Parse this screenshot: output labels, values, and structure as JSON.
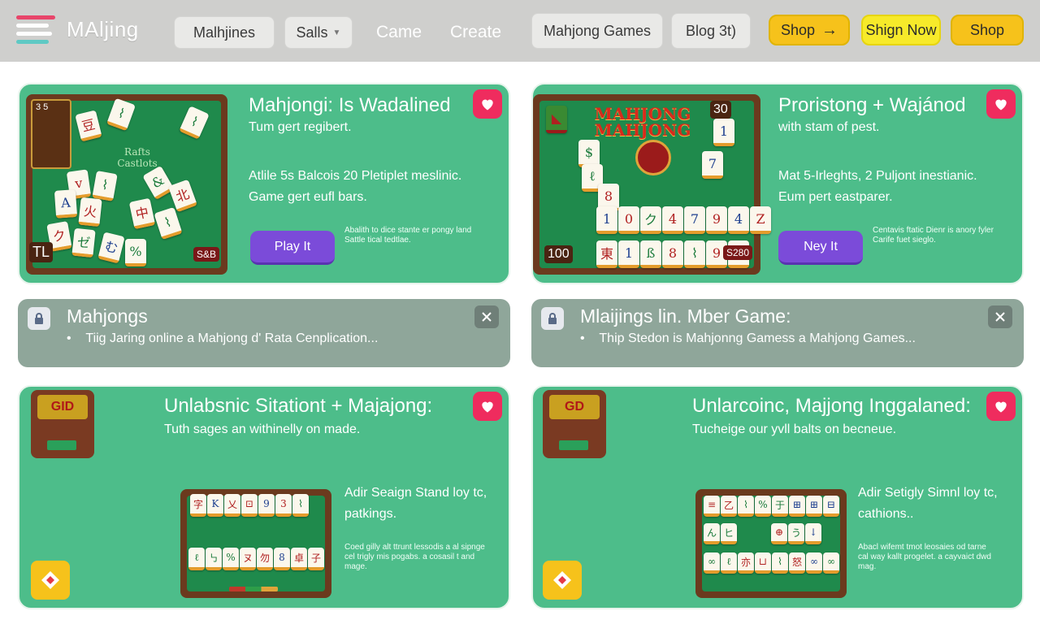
{
  "header": {
    "logo_text": "MAljing",
    "nav": [
      {
        "label": "Malhjines"
      },
      {
        "label": "Salls"
      },
      {
        "label": "Came"
      },
      {
        "label": "Create"
      },
      {
        "label": "Mahjong Games"
      },
      {
        "label": "Blog 3t)"
      }
    ],
    "shop_primary": "Shop",
    "sign_now": "Shign Now",
    "shop_secondary": "Shop"
  },
  "cards": [
    {
      "title": "Mahjongi: Is Wadalined",
      "subtitle": "Tum gert regibert.",
      "body_line1": "Atlile 5s Balcois 20 Pletiplet meslinic.",
      "body_line2": "Game gert eufl bars.",
      "fine_line1": "Abalith to dice stante er pongy land",
      "fine_line2": "Sattle tical tedtlae.",
      "button": "Play It",
      "art": {
        "score_top": "3 5",
        "corner_left": "TL",
        "corner_right": "S&B",
        "panel_text": "Rafts Castlots"
      }
    },
    {
      "title": "Proristong + Wajánod",
      "subtitle": "with stam of pest.",
      "body_line1": "Mat 5-Irleghts, 2 Puljont inestianic.",
      "body_line2": "Eum pert eastparer.",
      "fine_line1": "Centavis ftatic Dienr is anory fyler",
      "fine_line2": "Carife fuet sieglo.",
      "button": "Ney It",
      "art": {
        "banner": "MAHJONG MAHJONG",
        "score_top": "30",
        "corner_left": "100",
        "corner_right": "S280",
        "row_text": "10 14 7 9 4 Z"
      }
    },
    {
      "title": "Unlabsnic Sitationt + Majajong:",
      "subtitle": "Tuth sages an withinelly on made.",
      "body_line1": "Adir Seaign Stand loy tc,",
      "body_line2": "patkings.",
      "fine_line1": "Coed gilly alt ttrunt lessodis a al sipnge",
      "fine_line2": "cel trigly mis pogabs. a cosasil t and",
      "fine_line3": "mage.",
      "machine_text": "GID"
    },
    {
      "title": "Unlarcoinc, Majjong Inggalaned:",
      "subtitle": "Tucheige our yvll balts on becneue.",
      "body_line1": "Adir Setigly Simnl loy tc,",
      "body_line2": "cathions..",
      "fine_line1": "Abacl wifemt tmot leosaies od tarne",
      "fine_line2": "cal way kallt progelet. a cayvaict dwd",
      "fine_line3": "mag.",
      "machine_text": "GD"
    }
  ],
  "notices": [
    {
      "title": "Mahjongs",
      "text": "Tiig Jaring online a Mahjong d' Rata Cenplication..."
    },
    {
      "title": "Mlaijings lin. Mber Game:",
      "text": "Thip Stedon is Mahjonng Gamess a Mahjong Games..."
    }
  ],
  "colors": {
    "header_bg": "#cfcfcd",
    "card_green": "#4dbd8a",
    "notice_grey": "#8fa69a",
    "heart_red": "#ef2c5e",
    "button_purple": "#7b4bd9",
    "shop_yellow": "#f6c21b",
    "sign_yellow": "#f7ea2a"
  },
  "icons": [
    "hamburger-logo-icon",
    "arrow-right-icon",
    "heart-icon",
    "lock-icon",
    "close-icon",
    "diamond-icon"
  ]
}
